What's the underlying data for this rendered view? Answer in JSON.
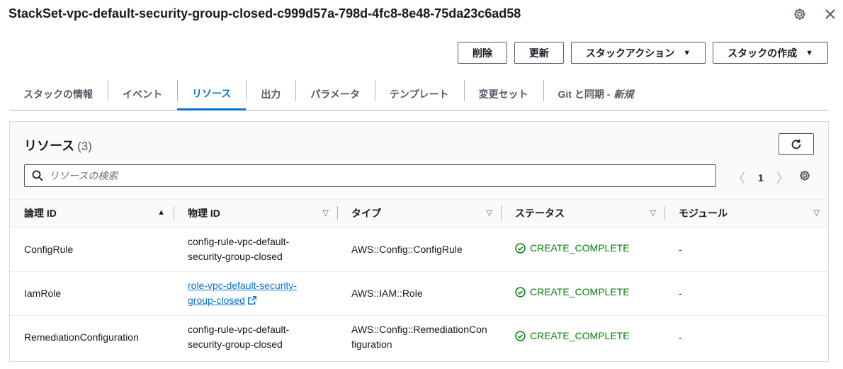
{
  "page": {
    "title": "StackSet-vpc-default-security-group-closed-c999d57a-798d-4fc8-8e48-75da23c6ad58"
  },
  "actions": {
    "delete": "削除",
    "update": "更新",
    "stack_actions": "スタックアクション",
    "create_stack": "スタックの作成"
  },
  "tabs": [
    {
      "label": "スタックの情報"
    },
    {
      "label": "イベント"
    },
    {
      "label": "リソース"
    },
    {
      "label": "出力"
    },
    {
      "label": "パラメータ"
    },
    {
      "label": "テンプレート"
    },
    {
      "label": "変更セット"
    },
    {
      "label": "Git と同期 - ",
      "tag": "新規"
    }
  ],
  "active_tab": "リソース",
  "panel": {
    "title": "リソース",
    "count": "(3)",
    "search_placeholder": "リソースの検索",
    "page": "1"
  },
  "table": {
    "columns": [
      "論理 ID",
      "物理 ID",
      "タイプ",
      "ステータス",
      "モジュール"
    ],
    "sort_column": "論理 ID",
    "rows": [
      {
        "logical_id": "ConfigRule",
        "physical_id": [
          "config-rule-vpc-default-",
          "security-group-closed"
        ],
        "physical_link": false,
        "type": [
          "AWS::Config::ConfigRule"
        ],
        "status": "CREATE_COMPLETE",
        "module": "-"
      },
      {
        "logical_id": "IamRole",
        "physical_id": [
          "role-vpc-default-security-",
          "group-closed"
        ],
        "physical_link": true,
        "type": [
          "AWS::IAM::Role"
        ],
        "status": "CREATE_COMPLETE",
        "module": "-"
      },
      {
        "logical_id": "RemediationConfiguration",
        "physical_id": [
          "config-rule-vpc-default-",
          "security-group-closed"
        ],
        "physical_link": false,
        "type": [
          "AWS::Config::RemediationCon",
          "figuration"
        ],
        "status": "CREATE_COMPLETE",
        "module": "-"
      }
    ]
  },
  "colors": {
    "accent": "#0972d3",
    "success": "#037f0c",
    "text": "#16191f",
    "border": "#aab7b8"
  },
  "icons": {
    "settings": "gear-icon",
    "close": "close-icon",
    "refresh": "refresh-icon",
    "search": "search-icon",
    "status": "check-circle-icon",
    "external": "external-link-icon"
  }
}
